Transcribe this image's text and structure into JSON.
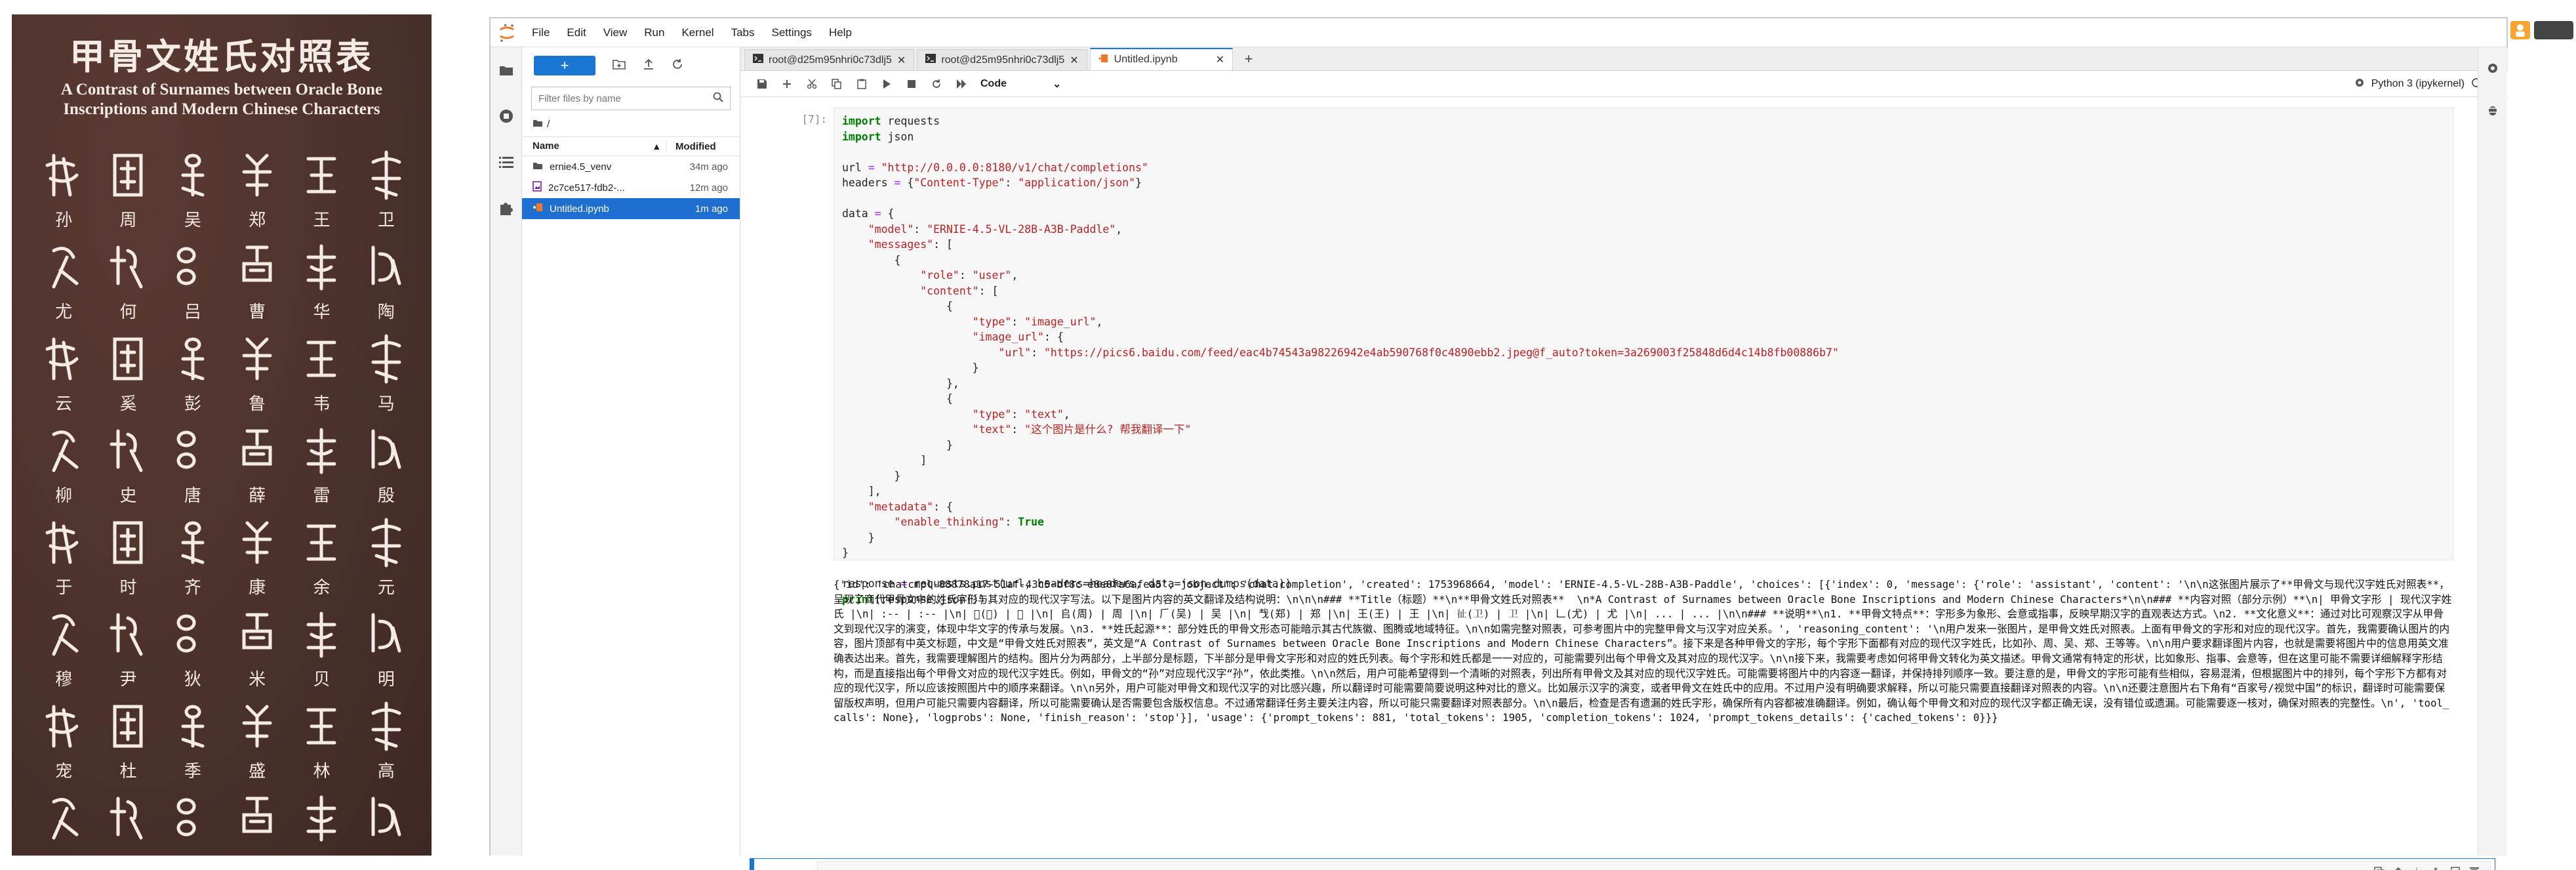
{
  "poster": {
    "title": "甲骨文姓氏对照表",
    "subtitle_line1": "A Contrast of Surnames between Oracle Bone",
    "subtitle_line2": "Inscriptions and Modern Chinese Characters",
    "characters": [
      "孙",
      "周",
      "吴",
      "郑",
      "王",
      "卫",
      "尤",
      "何",
      "吕",
      "曹",
      "华",
      "陶",
      "云",
      "奚",
      "彭",
      "鲁",
      "韦",
      "马",
      "柳",
      "史",
      "唐",
      "薛",
      "雷",
      "殷",
      "于",
      "时",
      "齐",
      "康",
      "余",
      "元",
      "穆",
      "尹",
      "狄",
      "米",
      "贝",
      "明",
      "宠",
      "杜",
      "季",
      "盛",
      "林",
      "高",
      "",
      "",
      "",
      "",
      "",
      ""
    ]
  },
  "menubar": {
    "items": [
      "File",
      "Edit",
      "View",
      "Run",
      "Kernel",
      "Tabs",
      "Settings",
      "Help"
    ]
  },
  "filebrowser": {
    "new_label": "+",
    "filter_placeholder": "Filter files by name",
    "path": "/",
    "col_name": "Name",
    "col_modified": "Modified",
    "files": [
      {
        "name": "ernie4.5_venv",
        "modified": "34m ago",
        "type": "folder"
      },
      {
        "name": "2c7ce517-fdb2-...",
        "modified": "12m ago",
        "type": "file"
      },
      {
        "name": "Untitled.ipynb",
        "modified": "1m ago",
        "type": "notebook"
      }
    ]
  },
  "tabs": [
    {
      "label": "root@d25m95nhri0c73dlj5"
    },
    {
      "label": "root@d25m95nhri0c73dlj5"
    },
    {
      "label": "Untitled.ipynb"
    }
  ],
  "toolbar": {
    "cell_type": "Code",
    "kernel_name": "Python 3 (ipykernel)"
  },
  "cell1": {
    "prompt": "[7]:",
    "code_lines": [
      "import requests",
      "import json",
      "",
      "url = \"http://0.0.0.0:8180/v1/chat/completions\"",
      "headers = {\"Content-Type\": \"application/json\"}",
      "",
      "data = {",
      "    \"model\": \"ERNIE-4.5-VL-28B-A3B-Paddle\",",
      "    \"messages\": [",
      "        {",
      "            \"role\": \"user\",",
      "            \"content\": [",
      "                {",
      "                    \"type\": \"image_url\",",
      "                    \"image_url\": {",
      "                        \"url\": \"https://pics6.baidu.com/feed/eac4b74543a98226942e4ab590768f0c4890ebb2.jpeg@f_auto?token=3a269003f25848d6d4c14b8fb00886b7\"",
      "                    }",
      "                },",
      "                {",
      "                    \"type\": \"text\",",
      "                    \"text\": \"这个图片是什么? 帮我翻译一下\"",
      "                }",
      "            ]",
      "        }",
      "    ],",
      "    \"metadata\": {",
      "        \"enable_thinking\": True",
      "    }",
      "}",
      "",
      "response = requests.post(url, headers=headers, data=json.dumps(data))",
      "print(response.json())"
    ],
    "output": "{'id': 'chatcmpl-88878a17-51af-43c5-bf8c-e8e0fa6afea5', 'object': 'chat.completion', 'created': 1753968664, 'model': 'ERNIE-4.5-VL-28B-A3B-Paddle', 'choices': [{'index': 0, 'message': {'role': 'assistant', 'content': '\\n\\n这张图片展示了**甲骨文与现代汉字姓氏对照表**，呈现了商代甲骨文中的姓氏字形与其对应的现代汉字写法。以下是图片内容的英文翻译及结构说明：\\n\\n\\n### **Title（标题）**\\n**甲骨文姓氏对照表**  \\n*A Contrast of Surnames between Oracle Bone Inscriptions and Modern Chinese Characters*\\n\\n### **内容对照（部分示例）**\\n| 甲骨文字形 | 现代汉字姓氏 |\\n| :-- | :-- |\\n| 𤓰(孙) | 孙 |\\n| 𠂤(周) | 周 |\\n| 𠂆(吴) | 吴 |\\n| 𢦏(郑) | 郑 |\\n| 王(王) | 王 |\\n| 𢓊(卫) | 卫 |\\n| 𠃊(尤) | 尤 |\\n| ... | ... |\\n\\n### **说明**\\n1. **甲骨文特点**：字形多为象形、会意或指事，反映早期汉字的直观表达方式。\\n2. **文化意义**：通过对比可观察汉字从甲骨文到现代汉字的演变，体现中华文字的传承与发展。\\n3. **姓氏起源**：部分姓氏的甲骨文形态可能暗示其古代族徽、图腾或地域特征。\\n\\n如需完整对照表，可参考图片中的完整甲骨文与汉字对应关系。', 'reasoning_content': '\\n用户发来一张图片，是甲骨文姓氏对照表。上面有甲骨文的字形和对应的现代汉字。首先，我需要确认图片的内容，图片顶部有中英文标题，中文是“甲骨文姓氏对照表”，英文是“A Contrast of Surnames between Oracle Bone Inscriptions and Modern Chinese Characters”。接下来是各种甲骨文的字形，每个字形下面都有对应的现代汉字姓氏，比如孙、周、吴、郑、王等等。\\n\\n用户要求翻译图片内容，也就是需要将图片中的信息用英文准确表达出来。首先，我需要理解图片的结构。图片分为两部分，上半部分是标题，下半部分是甲骨文字形和对应的姓氏列表。每个字形和姓氏都是一一对应的，可能需要列出每个甲骨文及其对应的现代汉字。\\n\\n接下来，我需要考虑如何将甲骨文转化为英文描述。甲骨文通常有特定的形状，比如象形、指事、会意等，但在这里可能不需要详细解释字形结构，而是直接指出每个甲骨文对应的现代汉字姓氏。例如，甲骨文的“孙”对应现代汉字“孙”，依此类推。\\n\\n然后，用户可能希望得到一个清晰的对照表，列出所有甲骨文及其对应的现代汉字姓氏。可能需要将图片中的内容逐一翻译，并保持排列顺序一致。要注意的是，甲骨文的字形可能有些相似，容易混淆，但根据图片中的排列，每个字形下方都有对应的现代汉字，所以应该按照图片中的顺序来翻译。\\n\\n另外，用户可能对甲骨文和现代汉字的对比感兴趣，所以翻译时可能需要简要说明这种对比的意义。比如展示汉字的演变，或者甲骨文在姓氏中的应用。不过用户没有明确要求解释，所以可能只需要直接翻译对照表的内容。\\n\\n还要注意图片右下角有“百家号/视觉中国”的标识，翻译时可能需要保留版权声明，但用户可能只需要内容翻译，所以可能需要确认是否需要包含版权信息。不过通常翻译任务主要关注内容，所以可能只需要翻译对照表部分。\\n\\n最后，检查是否有遗漏的姓氏字形，确保所有内容都被准确翻译。例如，确认每个甲骨文和对应的现代汉字都正确无误，没有错位或遗漏。可能需要逐一核对，确保对照表的完整性。\\n', 'tool_calls': None}, 'logprobs': None, 'finish_reason': 'stop'}], 'usage': {'prompt_tokens': 881, 'total_tokens': 1905, 'completion_tokens': 1024, 'prompt_tokens_details': {'cached_tokens': 0}}}"
  },
  "cell2": {
    "prompt": "[ ]:"
  },
  "colors": {
    "accent": "#1976d2",
    "poster_bg": "#4a302b",
    "selected_row": "#1f6fd0"
  }
}
